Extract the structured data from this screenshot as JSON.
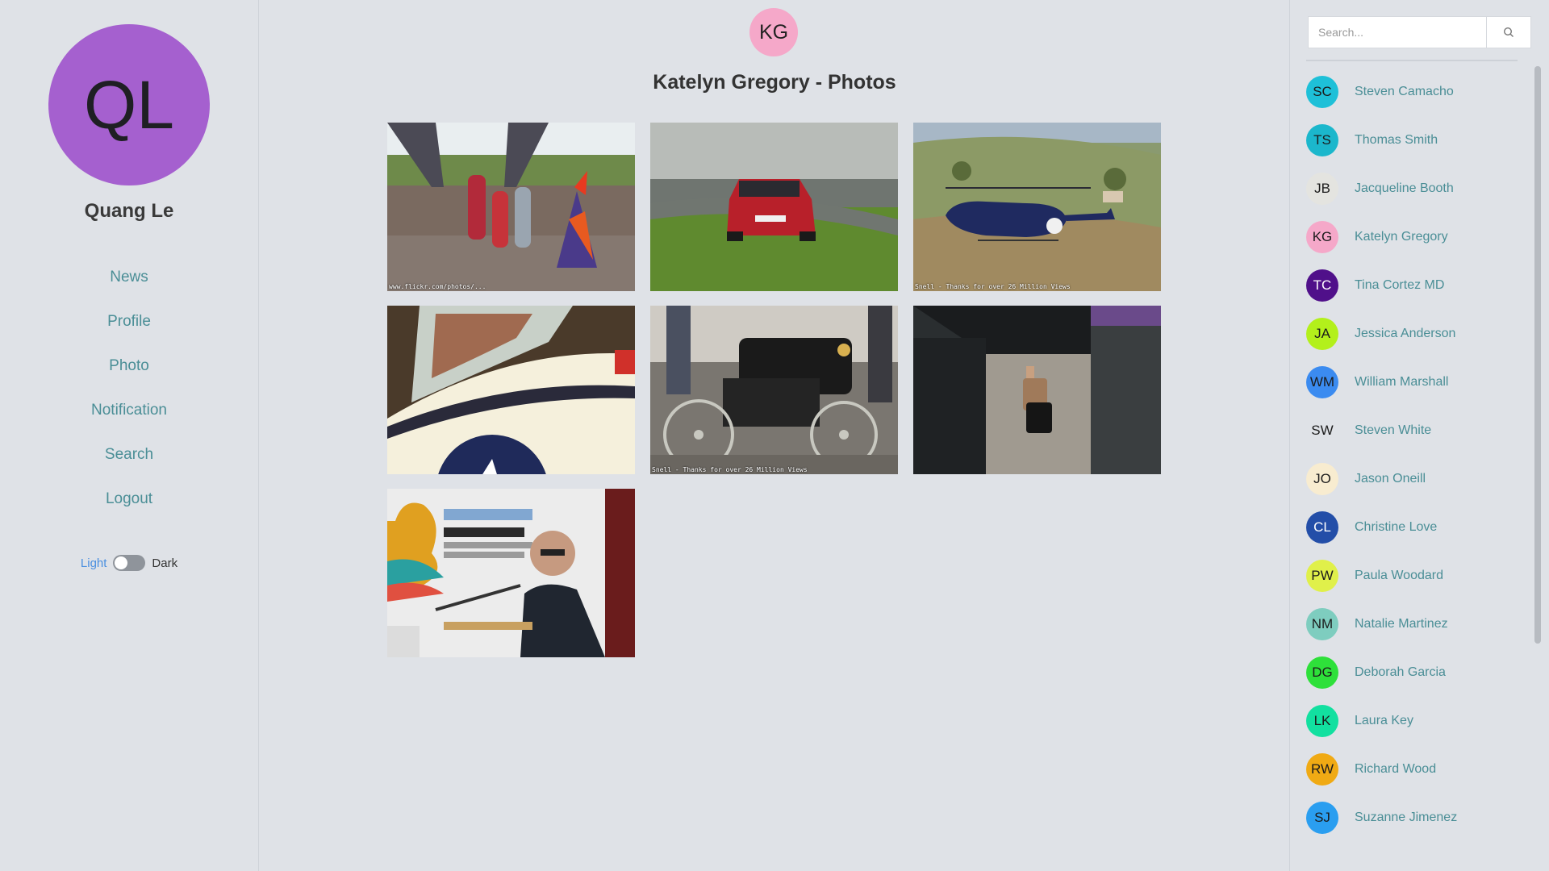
{
  "sidebar": {
    "avatar_initials": "QL",
    "avatar_color": "#a560cf",
    "user_name": "Quang Le",
    "nav": [
      {
        "label": "News"
      },
      {
        "label": "Profile"
      },
      {
        "label": "Photo"
      },
      {
        "label": "Notification"
      },
      {
        "label": "Search"
      },
      {
        "label": "Logout"
      }
    ],
    "theme": {
      "light_label": "Light",
      "dark_label": "Dark",
      "mode": "light"
    }
  },
  "main": {
    "avatar_initials": "KG",
    "avatar_color": "#f5a8c9",
    "title": "Katelyn Gregory - Photos",
    "photos": [
      {
        "subject": "children-with-costume-on-deck",
        "watermark": "www.flickr.com/photos/..."
      },
      {
        "subject": "red-car-on-grass-track",
        "watermark": ""
      },
      {
        "subject": "helicopter-over-hills",
        "watermark": "Snell - Thanks for over 26 Million Views"
      },
      {
        "subject": "aircraft-cockpit-closeup",
        "watermark": ""
      },
      {
        "subject": "vintage-automobile",
        "watermark": "Snell - Thanks for over 26 Million Views"
      },
      {
        "subject": "woman-with-suitcase-in-terminal",
        "watermark": ""
      },
      {
        "subject": "speaker-at-podium",
        "watermark": ""
      }
    ]
  },
  "right_panel": {
    "search_placeholder": "Search...",
    "contacts": [
      {
        "initials": "SC",
        "name": "Steven Camacho",
        "color": "#1ec0d8",
        "text": "#1b1b1b"
      },
      {
        "initials": "TS",
        "name": "Thomas Smith",
        "color": "#1bb7cc",
        "text": "#1b1b1b"
      },
      {
        "initials": "JB",
        "name": "Jacqueline Booth",
        "color": "#e4e4e0",
        "text": "#1b1b1b"
      },
      {
        "initials": "KG",
        "name": "Katelyn Gregory",
        "color": "#f5a8c9",
        "text": "#1b1b1b"
      },
      {
        "initials": "TC",
        "name": "Tina Cortez MD",
        "color": "#50108a",
        "text": "#ffffff"
      },
      {
        "initials": "JA",
        "name": "Jessica Anderson",
        "color": "#b3f01b",
        "text": "#1b1b1b"
      },
      {
        "initials": "WM",
        "name": "William Marshall",
        "color": "#3b8bf0",
        "text": "#1b1b1b"
      },
      {
        "initials": "SW",
        "name": "Steven White",
        "color": "#dfe2e7",
        "text": "#1b1b1b"
      },
      {
        "initials": "JO",
        "name": "Jason Oneill",
        "color": "#f8ecd0",
        "text": "#1b1b1b"
      },
      {
        "initials": "CL",
        "name": "Christine Love",
        "color": "#234ea8",
        "text": "#ffffff"
      },
      {
        "initials": "PW",
        "name": "Paula Woodard",
        "color": "#e0f04a",
        "text": "#1b1b1b"
      },
      {
        "initials": "NM",
        "name": "Natalie Martinez",
        "color": "#7ecdbf",
        "text": "#1b1b1b"
      },
      {
        "initials": "DG",
        "name": "Deborah Garcia",
        "color": "#2ee03a",
        "text": "#1b1b1b"
      },
      {
        "initials": "LK",
        "name": "Laura Key",
        "color": "#12e0a0",
        "text": "#1b1b1b"
      },
      {
        "initials": "RW",
        "name": "Richard Wood",
        "color": "#f0aa14",
        "text": "#1b1b1b"
      },
      {
        "initials": "SJ",
        "name": "Suzanne Jimenez",
        "color": "#2a9ef0",
        "text": "#1b1b1b"
      },
      {
        "initials": "",
        "name": "",
        "color": "#2ed84a",
        "text": "#1b1b1b"
      }
    ]
  }
}
